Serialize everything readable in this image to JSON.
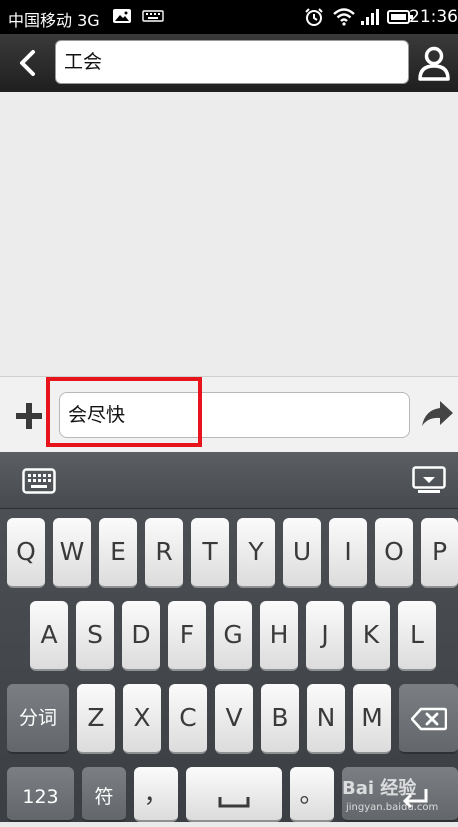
{
  "status_bar": {
    "carrier": "中国移动 3G",
    "time": "21:36",
    "icons": [
      "image-icon",
      "keyboard-icon",
      "alarm-icon",
      "wifi-icon",
      "signal-icon",
      "battery-icon"
    ]
  },
  "header": {
    "recipient": "工会",
    "icons": [
      "back-arrow-icon",
      "contact-icon"
    ]
  },
  "compose": {
    "message_text": "会尽快",
    "icons": [
      "plus-icon",
      "send-arrow-icon"
    ],
    "highlight_color": "#e8141c"
  },
  "keyboard": {
    "row1": [
      "Q",
      "W",
      "E",
      "R",
      "T",
      "Y",
      "U",
      "I",
      "O",
      "P"
    ],
    "row2": [
      "A",
      "S",
      "D",
      "F",
      "G",
      "H",
      "J",
      "K",
      "L"
    ],
    "row3": [
      "Z",
      "X",
      "C",
      "V",
      "B",
      "N",
      "M"
    ],
    "segment_key": "分词",
    "numbers_key": "123",
    "symbols_key": "符",
    "comma_key": "，",
    "period_key": "。",
    "icons": [
      "keyboard-toggle-icon",
      "hide-keyboard-icon",
      "backspace-icon",
      "space-icon",
      "enter-icon"
    ]
  },
  "watermark": {
    "main": "Bai 经验",
    "sub": "jingyan.baidu.com"
  }
}
